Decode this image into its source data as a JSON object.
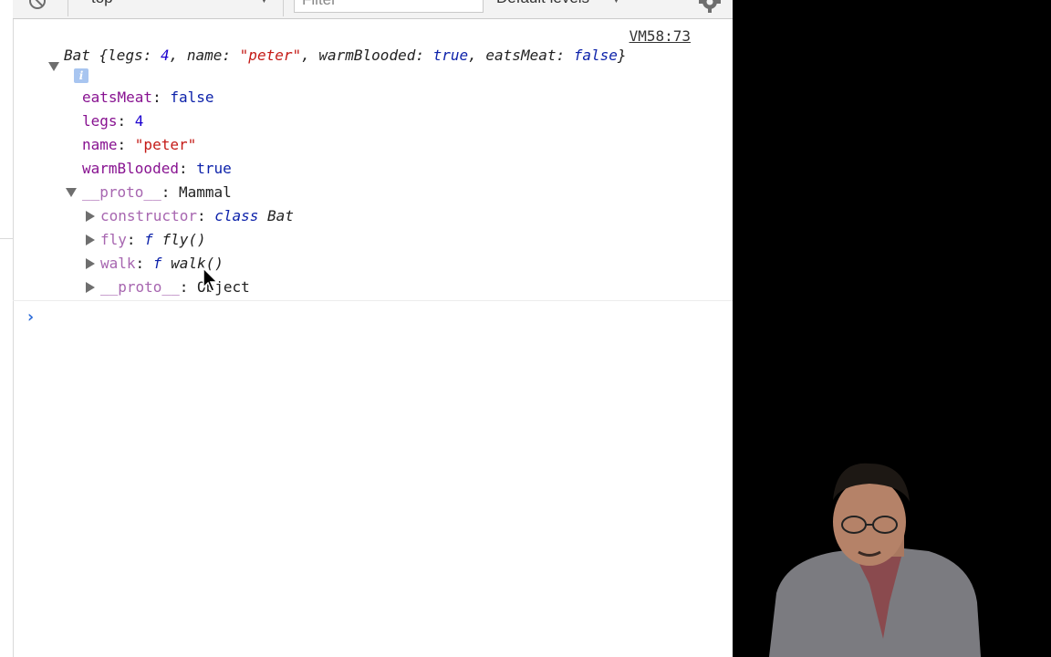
{
  "toolbar": {
    "context": "top",
    "filter_placeholder": "Filter",
    "levels": "Default levels"
  },
  "console": {
    "source_link": "VM58:73",
    "summary": {
      "class_name": "Bat",
      "open_brace": " {",
      "legs_key": "legs",
      "legs_value": "4",
      "name_key": "name",
      "name_value": "\"peter\"",
      "warm_key": "warmBlooded",
      "warm_value": "true",
      "eats_key": "eatsMeat",
      "eats_value": "false",
      "close_brace": "}"
    },
    "info_badge": "i",
    "properties": [
      {
        "key": "eatsMeat",
        "value": "false"
      },
      {
        "key": "legs",
        "value": "4"
      },
      {
        "key": "name",
        "value": "\"peter\""
      },
      {
        "key": "warmBlooded",
        "value": "true"
      }
    ],
    "proto": {
      "key": "__proto__",
      "value": "Mammal",
      "children": [
        {
          "key": "constructor",
          "keyword": "class",
          "value": "Bat"
        },
        {
          "key": "fly",
          "keyword": "f",
          "value": "fly()"
        },
        {
          "key": "walk",
          "keyword": "f",
          "value": "walk()"
        },
        {
          "key": "__proto__",
          "value": "Object"
        }
      ]
    }
  }
}
